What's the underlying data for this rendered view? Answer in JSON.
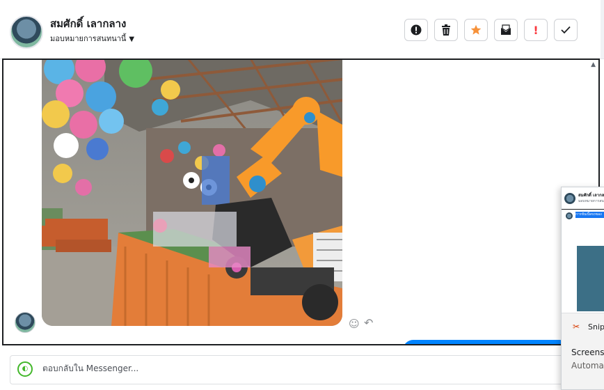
{
  "header": {
    "contact_name": "สมศักดิ์ เลากลาง",
    "assign_label": "มอบหมายการสนทนานี้",
    "toolbar": [
      {
        "id": "spam",
        "icon": "alert-circle-icon",
        "glyph": "❗"
      },
      {
        "id": "delete",
        "icon": "trash-icon",
        "glyph": "🗑"
      },
      {
        "id": "star",
        "icon": "star-icon",
        "glyph": "★"
      },
      {
        "id": "mark-unread",
        "icon": "envelope-icon",
        "glyph": "✉"
      },
      {
        "id": "follow-up",
        "icon": "exclamation-icon",
        "glyph": "!"
      },
      {
        "id": "done",
        "icon": "checkmark-icon",
        "glyph": "✓"
      }
    ]
  },
  "thread": {
    "react_glyph": "☺",
    "reply_glyph": "↶"
  },
  "composer": {
    "placeholder": "ตอบกลับใน Messenger..."
  },
  "popup": {
    "contact_name": "สมศักดิ์ เลากลาง",
    "assign_label": "มอบหมายการสนทนานี้",
    "highlight_text": "การขับเบิ้ลรถของ",
    "snip_label": "Snip",
    "snip_title": "Screens",
    "snip_subtitle": "Automa"
  },
  "colors": {
    "accent": "#0084ff",
    "star": "#f7923a",
    "alert": "#fa383e"
  }
}
